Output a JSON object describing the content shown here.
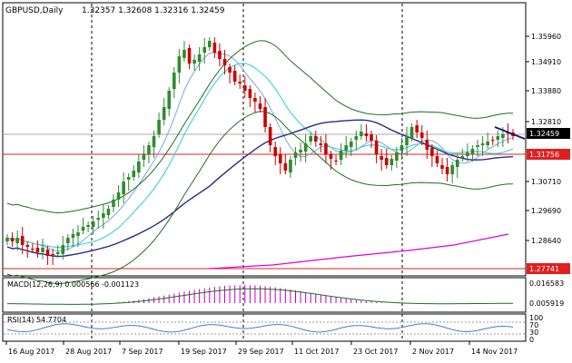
{
  "chart_title": "GBPUSD,Daily",
  "ohlc": "1.32357 1.32608 1.32316 1.32459",
  "price_axis": [
    "1.35960",
    "1.34910",
    "1.33880",
    "1.32810",
    "1.30710",
    "1.29690",
    "1.28640"
  ],
  "tags": {
    "current": "1.32459",
    "red_level": "1.31756",
    "low_level": "1.27741"
  },
  "macd": {
    "label": "MACD(12,26,9) 0.000566 -0.001123",
    "axis": [
      "0.016583",
      "0.005919"
    ]
  },
  "rsi": {
    "label": "RSI(14) 54.7704",
    "axis": [
      "100",
      "70",
      "30",
      "0"
    ]
  },
  "dates": [
    "16 Aug 2017",
    "28 Aug 2017",
    "7 Sep 2017",
    "19 Sep 2017",
    "29 Sep 2017",
    "11 Oct 2017",
    "23 Oct 2017",
    "2 Nov 2017",
    "14 Nov 2017"
  ],
  "colors": {
    "bull": "#2e8b2e",
    "bear": "#cc0000",
    "bands": "#1f6f1f",
    "ma_fast": "#7aa7e0",
    "ma_mid": "#49d6d6",
    "ma_slow": "#2b2b8a",
    "ma_long": "#e000e0",
    "red_line": "#e02020",
    "macd_hist": "#c000c0",
    "macd_signal": "#1f6f1f"
  }
}
